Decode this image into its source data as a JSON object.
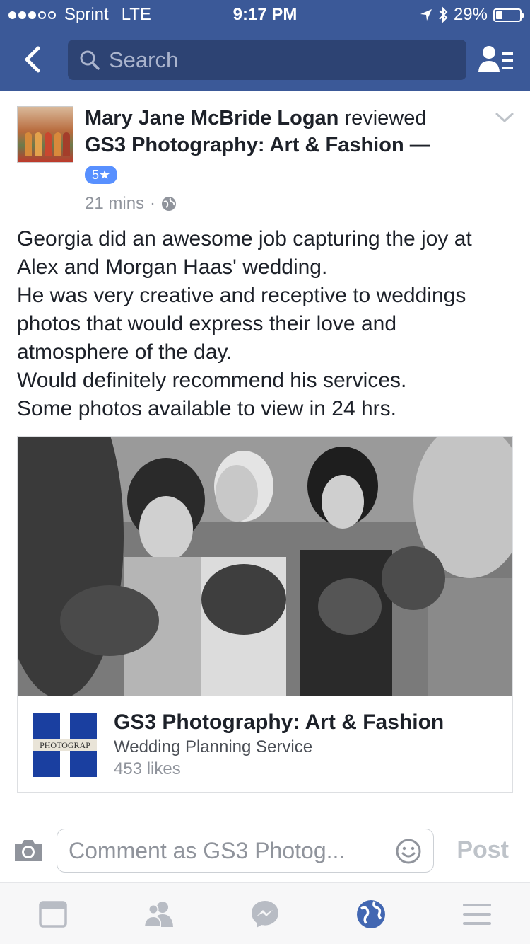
{
  "status_bar": {
    "carrier": "Sprint",
    "network": "LTE",
    "time": "9:17 PM",
    "battery": "29%",
    "battery_level": 0.29,
    "signal_bars": 3
  },
  "nav": {
    "search_placeholder": "Search"
  },
  "post": {
    "author": "Mary Jane McBride Logan",
    "action": "reviewed",
    "page": "GS3 Photography: Art & Fashion",
    "separator": "—",
    "rating": "5★",
    "time": "21 mins",
    "dot": "·",
    "body_lines": [
      "Georgia did an awesome job capturing the joy at",
      "Alex and Morgan Haas' wedding.",
      "He was very creative and receptive to weddings",
      "photos that would express their love and",
      "atmosphere of the day.",
      "Would definitely recommend his services.",
      "Some photos available to view in 24 hrs."
    ]
  },
  "card": {
    "page_name": "GS3 Photography: Art & Fashion",
    "category": "Wedding Planning Service",
    "likes": "453 likes",
    "thumb_label": "PHOTOGRAP"
  },
  "comment": {
    "placeholder": "Comment as GS3 Photog...",
    "post_label": "Post"
  },
  "tabs": [
    {
      "name": "news-feed",
      "icon": "news-feed-icon"
    },
    {
      "name": "friends",
      "icon": "friends-icon"
    },
    {
      "name": "messenger",
      "icon": "messenger-icon"
    },
    {
      "name": "notifications",
      "icon": "globe-icon",
      "active": true
    },
    {
      "name": "more",
      "icon": "menu-icon"
    }
  ],
  "colors": {
    "brand": "#3b5998",
    "accent": "#5890ff",
    "text": "#1d2129",
    "muted": "#90949c"
  }
}
